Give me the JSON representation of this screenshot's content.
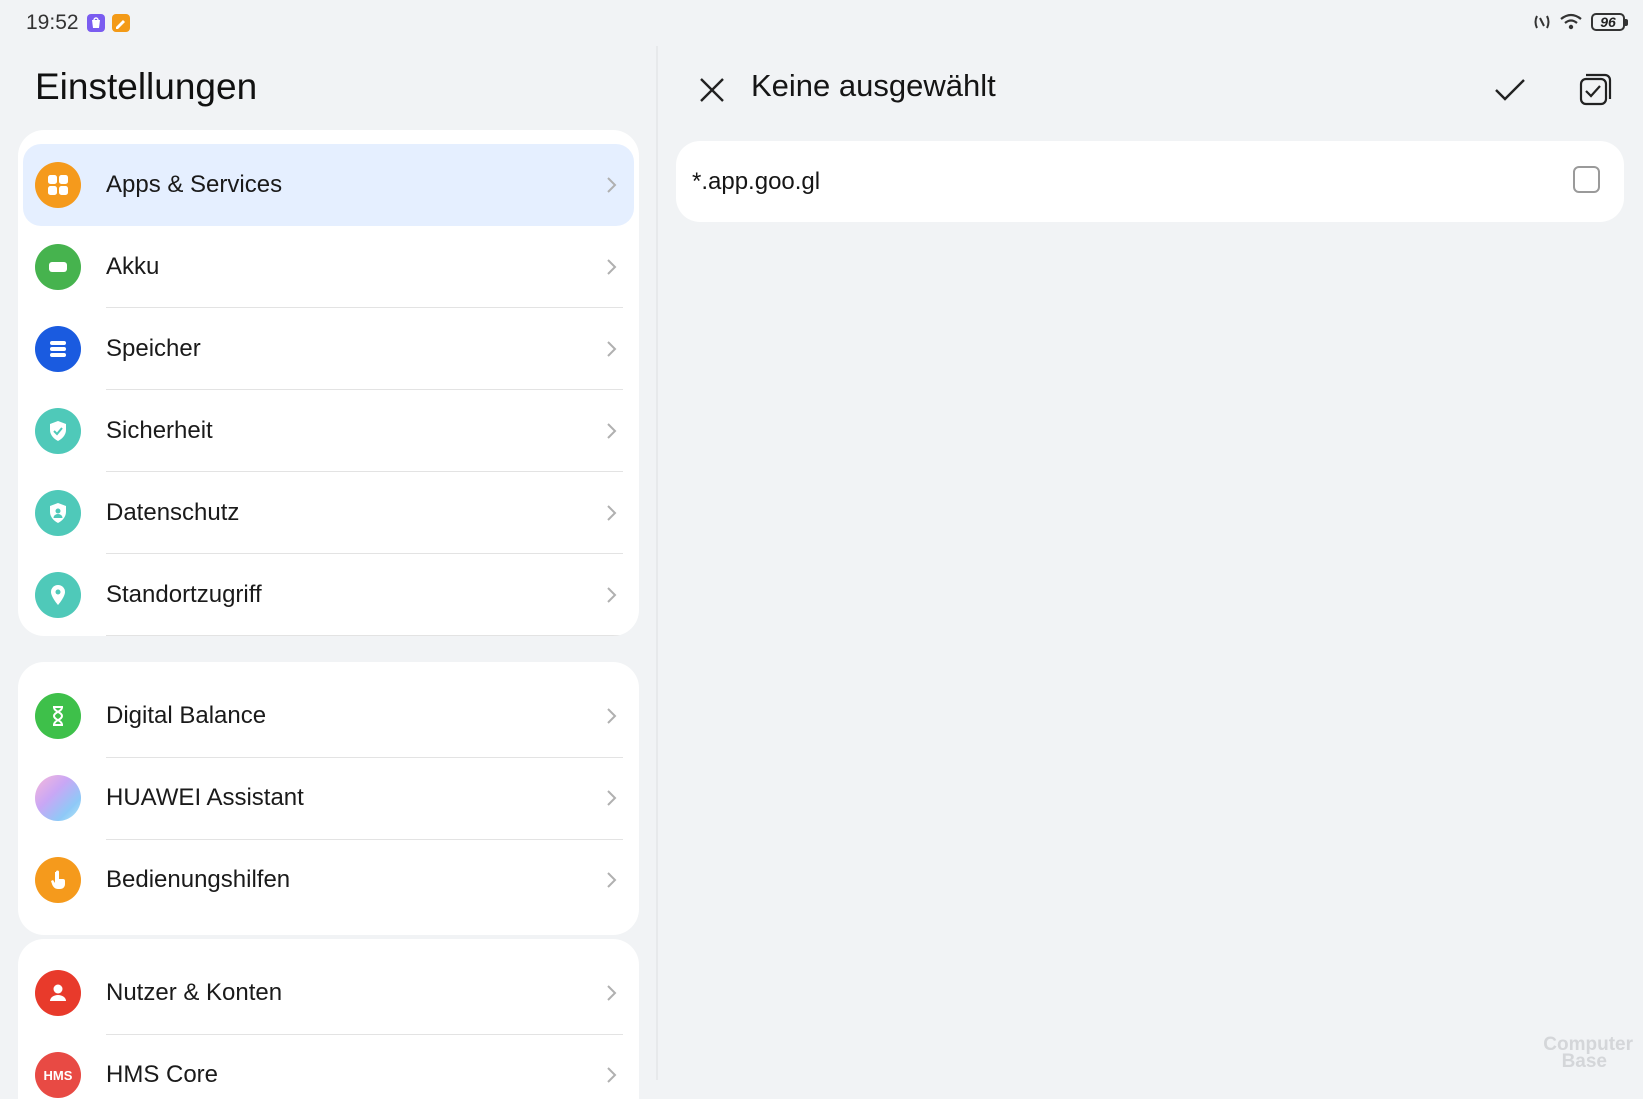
{
  "status_bar": {
    "time": "19:52",
    "battery": "96",
    "icons": [
      "app-notification-icon",
      "edit-notification-icon",
      "nfc-icon",
      "wifi-icon",
      "battery-icon"
    ]
  },
  "settings": {
    "title": "Einstellungen",
    "groups": [
      [
        {
          "label": "Apps & Services",
          "icon": "apps-icon",
          "color": "#f59a1c",
          "selected": true
        },
        {
          "label": "Akku",
          "icon": "battery-icon",
          "color": "#46b34e"
        },
        {
          "label": "Speicher",
          "icon": "storage-icon",
          "color": "#1a5be0"
        },
        {
          "label": "Sicherheit",
          "icon": "shield-check-icon",
          "color": "#4fc9b9"
        },
        {
          "label": "Datenschutz",
          "icon": "privacy-icon",
          "color": "#4fc9b9"
        },
        {
          "label": "Standortzugriff",
          "icon": "location-icon",
          "color": "#4fc9b9"
        }
      ],
      [
        {
          "label": "Digital Balance",
          "icon": "hourglass-icon",
          "color": "#3ec04a"
        },
        {
          "label": "HUAWEI Assistant",
          "icon": "assistant-icon",
          "color": "#c9a7f5"
        },
        {
          "label": "Bedienungshilfen",
          "icon": "accessibility-hand-icon",
          "color": "#f59a1c"
        }
      ],
      [
        {
          "label": "Nutzer & Konten",
          "icon": "user-icon",
          "color": "#e83a2b"
        },
        {
          "label": "HMS Core",
          "icon": "hms-icon",
          "color": "#e84a44",
          "icon_text": "HMS"
        }
      ]
    ]
  },
  "detail": {
    "title": "Keine ausgewählt",
    "items": [
      {
        "label": "*.app.goo.gl",
        "checked": false
      }
    ]
  },
  "watermark": {
    "line1": "Computer",
    "line2": "Base"
  }
}
